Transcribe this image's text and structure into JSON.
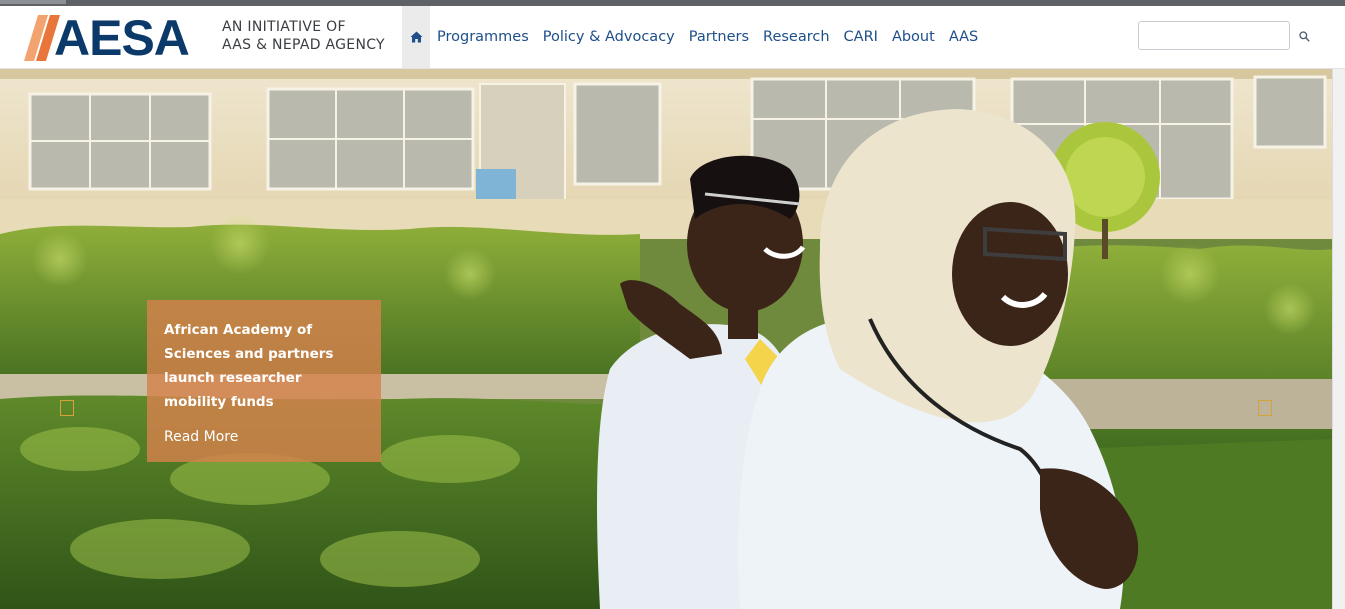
{
  "brand": {
    "name": "AESA",
    "tagline_1": "AN INITIATIVE OF",
    "tagline_2": "AAS & NEPAD AGENCY",
    "colors": {
      "navy": "#0b3a6a",
      "orange": "#e8763a",
      "orange_light": "#f2a36f"
    }
  },
  "nav": {
    "home_icon": "home-icon",
    "items": [
      {
        "label": "Programmes"
      },
      {
        "label": "Policy & Advocacy"
      },
      {
        "label": "Partners"
      },
      {
        "label": "Research"
      },
      {
        "label": "CARI"
      },
      {
        "label": "About"
      },
      {
        "label": "AAS"
      }
    ],
    "link_color": "#1e4f8a"
  },
  "search": {
    "value": "",
    "placeholder": "",
    "icon": "search-icon"
  },
  "hero": {
    "caption": {
      "headline": "African Academy of Sciences and partners launch researcher mobility funds",
      "link_label": "Read More",
      "background": "#d6814c"
    },
    "prev_icon": "prev-slide-icon",
    "next_icon": "next-slide-icon"
  }
}
